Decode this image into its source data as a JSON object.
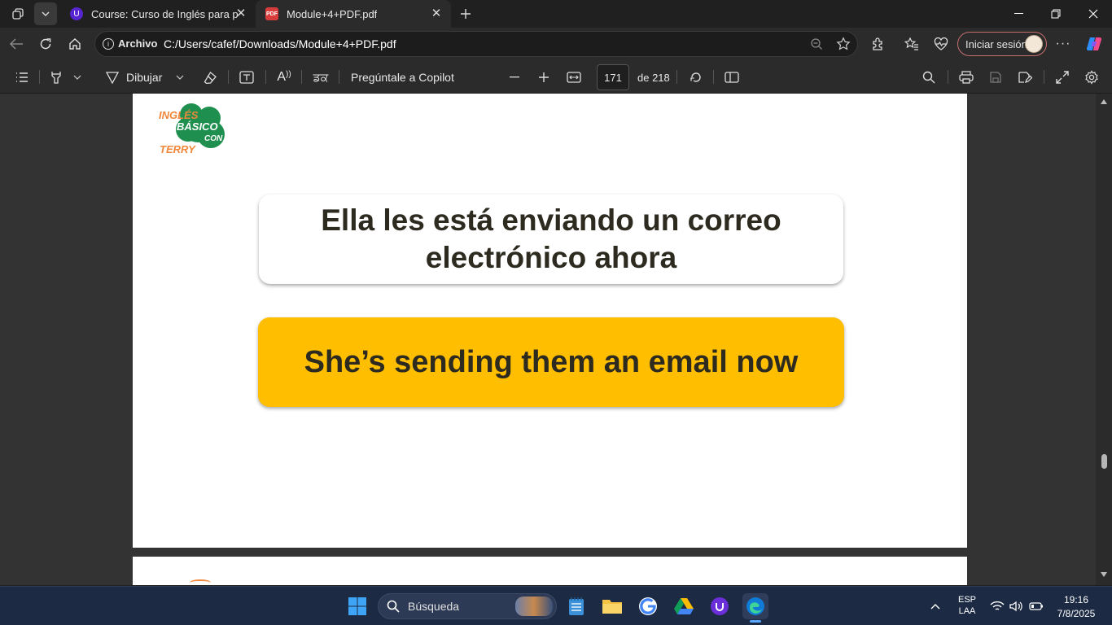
{
  "browser": {
    "tabs": [
      {
        "title": "Course: Curso de Inglés para princ",
        "favicon": "udemy-icon"
      },
      {
        "title": "Module+4+PDF.pdf",
        "favicon": "pdf-icon",
        "active": true
      }
    ],
    "address": {
      "security_label": "Archivo",
      "url": "C:/Users/cafef/Downloads/Module+4+PDF.pdf"
    },
    "signin_label": "Iniciar sesión"
  },
  "pdf_toolbar": {
    "draw_label": "Dibujar",
    "copilot_label": "Pregúntale a Copilot",
    "page_number": "171",
    "page_total": "de 218",
    "translate_glyph": "ਡਕ",
    "read_aloud_glyph": "A"
  },
  "page": {
    "logo": {
      "line1": "INGLÉS",
      "line2": "BÁSICO",
      "line3": "CON",
      "line4": "TERRY"
    },
    "spanish_sentence": "Ella les está enviando un correo electrónico ahora",
    "english_sentence": "She’s sending them an email now"
  },
  "taskbar": {
    "search_placeholder": "Búsqueda",
    "lang_top": "ESP",
    "lang_bottom": "LAA",
    "time": "19:16",
    "date": "7/8/2025"
  },
  "colors": {
    "accent_yellow": "#ffbf00",
    "logo_green": "#1e8f4e",
    "logo_orange": "#f0873a"
  }
}
